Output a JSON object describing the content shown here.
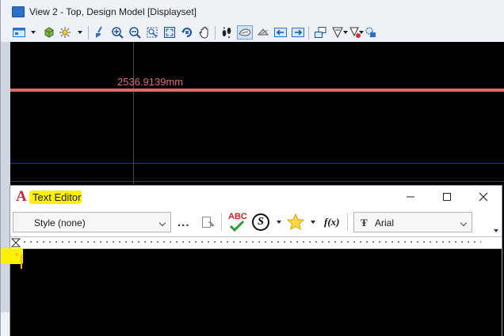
{
  "view_window": {
    "title": "View 2 - Top, Design Model [Displayset]"
  },
  "canvas": {
    "dimension_text": "2536.9139mm",
    "colors": {
      "background": "#000000",
      "dimension": "#e0686a",
      "guide": "#1e2fd0"
    }
  },
  "text_editor": {
    "title": "Text Editor",
    "logo": "A",
    "style_select": {
      "value": "Style (none)"
    },
    "more_label": "...",
    "spell_label": "ABC",
    "symbol_label": "S",
    "fx_label": "f(x)",
    "font_select": {
      "value": "Arial",
      "icon": "Ŧ"
    },
    "cursor_marker": "*",
    "highlight_color": "#fff200"
  }
}
